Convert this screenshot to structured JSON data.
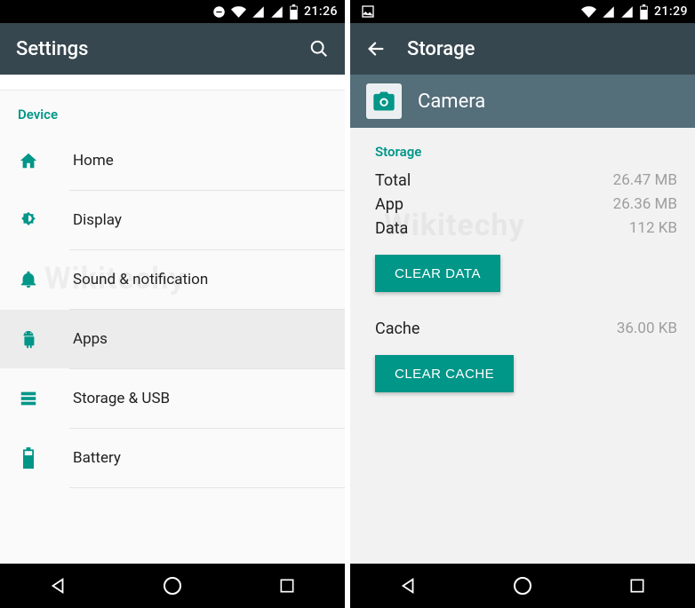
{
  "colors": {
    "accent": "#009688",
    "appbar": "#37474f",
    "subappbar": "#546e7a"
  },
  "left": {
    "status": {
      "clock": "21:26"
    },
    "appbar": {
      "title": "Settings"
    },
    "section_header": "Device",
    "items": [
      {
        "label": "Home"
      },
      {
        "label": "Display"
      },
      {
        "label": "Sound & notification"
      },
      {
        "label": "Apps"
      },
      {
        "label": "Storage & USB"
      },
      {
        "label": "Battery"
      }
    ]
  },
  "right": {
    "status": {
      "clock": "21:29"
    },
    "appbar": {
      "title": "Storage"
    },
    "subappbar": {
      "app_name": "Camera"
    },
    "section_header": "Storage",
    "rows": {
      "total": {
        "label": "Total",
        "value": "26.47 MB"
      },
      "app": {
        "label": "App",
        "value": "26.36 MB"
      },
      "data": {
        "label": "Data",
        "value": "112 KB"
      },
      "cache": {
        "label": "Cache",
        "value": "36.00 KB"
      }
    },
    "buttons": {
      "clear_data": "CLEAR DATA",
      "clear_cache": "CLEAR CACHE"
    }
  },
  "watermark": "Wikitechy"
}
